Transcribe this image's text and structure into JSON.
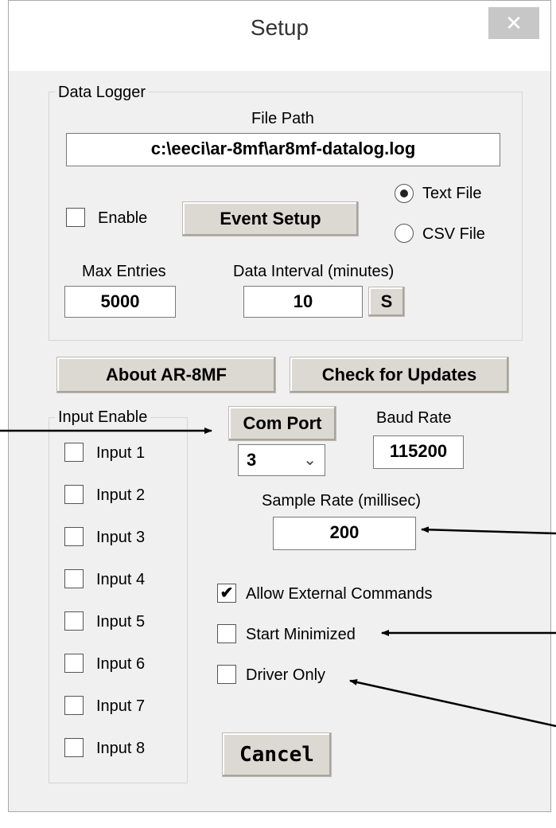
{
  "window": {
    "title": "Setup",
    "close_glyph": "✕"
  },
  "data_logger": {
    "legend": "Data Logger",
    "file_path_label": "File Path",
    "file_path_value": "c:\\eeci\\ar-8mf\\ar8mf-datalog.log",
    "enable_label": "Enable",
    "enable_checked": false,
    "event_setup_label": "Event Setup",
    "file_type_options": [
      {
        "label": "Text File",
        "selected": true
      },
      {
        "label": "CSV File",
        "selected": false
      }
    ],
    "max_entries_label": "Max Entries",
    "max_entries_value": "5000",
    "data_interval_label": "Data Interval (minutes)",
    "data_interval_value": "10",
    "s_button_label": "S"
  },
  "buttons": {
    "about_label": "About AR-8MF",
    "check_updates_label": "Check for Updates",
    "com_port_label": "Com Port",
    "cancel_label": "Cancel"
  },
  "input_enable": {
    "legend": "Input Enable",
    "inputs": [
      {
        "label": "Input 1",
        "checked": false
      },
      {
        "label": "Input 2",
        "checked": false
      },
      {
        "label": "Input 3",
        "checked": false
      },
      {
        "label": "Input 4",
        "checked": false
      },
      {
        "label": "Input 5",
        "checked": false
      },
      {
        "label": "Input 6",
        "checked": false
      },
      {
        "label": "Input 7",
        "checked": false
      },
      {
        "label": "Input 8",
        "checked": false
      }
    ]
  },
  "com": {
    "port_value": "3",
    "dropdown_icon": "chevron-down-icon",
    "baud_rate_label": "Baud Rate",
    "baud_rate_value": "115200",
    "sample_rate_label": "Sample Rate (millisec)",
    "sample_rate_value": "200"
  },
  "options": [
    {
      "label": "Allow External Commands",
      "checked": true
    },
    {
      "label": "Start Minimized",
      "checked": false
    },
    {
      "label": "Driver Only",
      "checked": false
    }
  ]
}
